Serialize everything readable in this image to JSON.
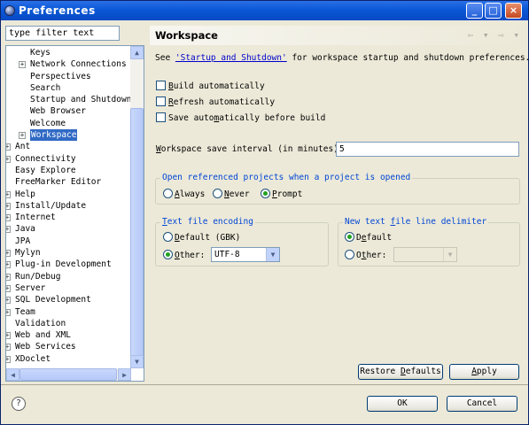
{
  "window": {
    "title": "Preferences",
    "buttons": {
      "minimize": "_",
      "maximize": "□",
      "close": "×"
    }
  },
  "filter": {
    "placeholder": "type filter text"
  },
  "tree": {
    "items": [
      {
        "label": "Keys",
        "level": 2,
        "expander": ""
      },
      {
        "label": "Network Connections",
        "level": 2,
        "expander": "+"
      },
      {
        "label": "Perspectives",
        "level": 2,
        "expander": ""
      },
      {
        "label": "Search",
        "level": 2,
        "expander": ""
      },
      {
        "label": "Startup and Shutdown",
        "level": 2,
        "expander": ""
      },
      {
        "label": "Web Browser",
        "level": 2,
        "expander": ""
      },
      {
        "label": "Welcome",
        "level": 2,
        "expander": ""
      },
      {
        "label": "Workspace",
        "level": 2,
        "expander": "+",
        "selected": true
      },
      {
        "label": "Ant",
        "level": 1,
        "expander": "+"
      },
      {
        "label": "Connectivity",
        "level": 1,
        "expander": "+"
      },
      {
        "label": "Easy Explore",
        "level": 1,
        "expander": ""
      },
      {
        "label": "FreeMarker Editor",
        "level": 1,
        "expander": ""
      },
      {
        "label": "Help",
        "level": 1,
        "expander": "+"
      },
      {
        "label": "Install/Update",
        "level": 1,
        "expander": "+"
      },
      {
        "label": "Internet",
        "level": 1,
        "expander": "+"
      },
      {
        "label": "Java",
        "level": 1,
        "expander": "+"
      },
      {
        "label": "JPA",
        "level": 1,
        "expander": ""
      },
      {
        "label": "Mylyn",
        "level": 1,
        "expander": "+"
      },
      {
        "label": "Plug-in Development",
        "level": 1,
        "expander": "+"
      },
      {
        "label": "Run/Debug",
        "level": 1,
        "expander": "+"
      },
      {
        "label": "Server",
        "level": 1,
        "expander": "+"
      },
      {
        "label": "SQL Development",
        "level": 1,
        "expander": "+"
      },
      {
        "label": "Team",
        "level": 1,
        "expander": "+"
      },
      {
        "label": "Validation",
        "level": 1,
        "expander": ""
      },
      {
        "label": "Web and XML",
        "level": 1,
        "expander": "+"
      },
      {
        "label": "Web Services",
        "level": 1,
        "expander": "+"
      },
      {
        "label": "XDoclet",
        "level": 1,
        "expander": "+"
      }
    ]
  },
  "page": {
    "title": "Workspace",
    "nav": "⇦ ▾ ⇨ ▾",
    "desc_pre": "See ",
    "desc_link": "'Startup and Shutdown'",
    "desc_post": " for workspace startup and shutdown preferences.",
    "checkboxes": [
      {
        "mn": "B",
        "rest": "uild automatically",
        "checked": false
      },
      {
        "mn": "R",
        "rest": "efresh automatically",
        "checked": false
      },
      {
        "pre": "Save auto",
        "mn": "m",
        "rest": "atically before build",
        "checked": false
      }
    ],
    "interval": {
      "mn": "W",
      "rest": "orkspace save interval (in minutes):",
      "value": "5"
    },
    "open_group": {
      "title": "Open referenced projects when a project is opened",
      "options": [
        {
          "mn": "A",
          "rest": "lways",
          "selected": false
        },
        {
          "mn": "N",
          "rest": "ever",
          "selected": false
        },
        {
          "mn": "P",
          "rest": "rompt",
          "selected": true
        }
      ]
    },
    "encoding_group": {
      "title_mn": "T",
      "title_rest": "ext file encoding",
      "default": {
        "mn": "D",
        "rest": "efault (GBK)",
        "selected": false
      },
      "other": {
        "mn": "O",
        "rest": "ther:",
        "selected": true
      },
      "combo_value": "UTF-8"
    },
    "delimiter_group": {
      "title_pre": "New text ",
      "title_mn": "f",
      "title_rest": "ile line delimiter",
      "default": {
        "pre": "D",
        "mn": "e",
        "rest": "fault",
        "selected": true
      },
      "other": {
        "pre": "O",
        "mn": "t",
        "rest": "her:",
        "selected": false
      },
      "combo_value": ""
    },
    "restore_button": {
      "pre": "Restore ",
      "mn": "D",
      "rest": "efaults"
    },
    "apply_button": {
      "mn": "A",
      "rest": "pply"
    }
  },
  "footer": {
    "help": "?",
    "ok": "OK",
    "cancel": "Cancel"
  },
  "colors": {
    "title_bar": "#0a58d6",
    "selection": "#316ac5",
    "group_title": "#0046d5",
    "link": "#0000cc"
  }
}
